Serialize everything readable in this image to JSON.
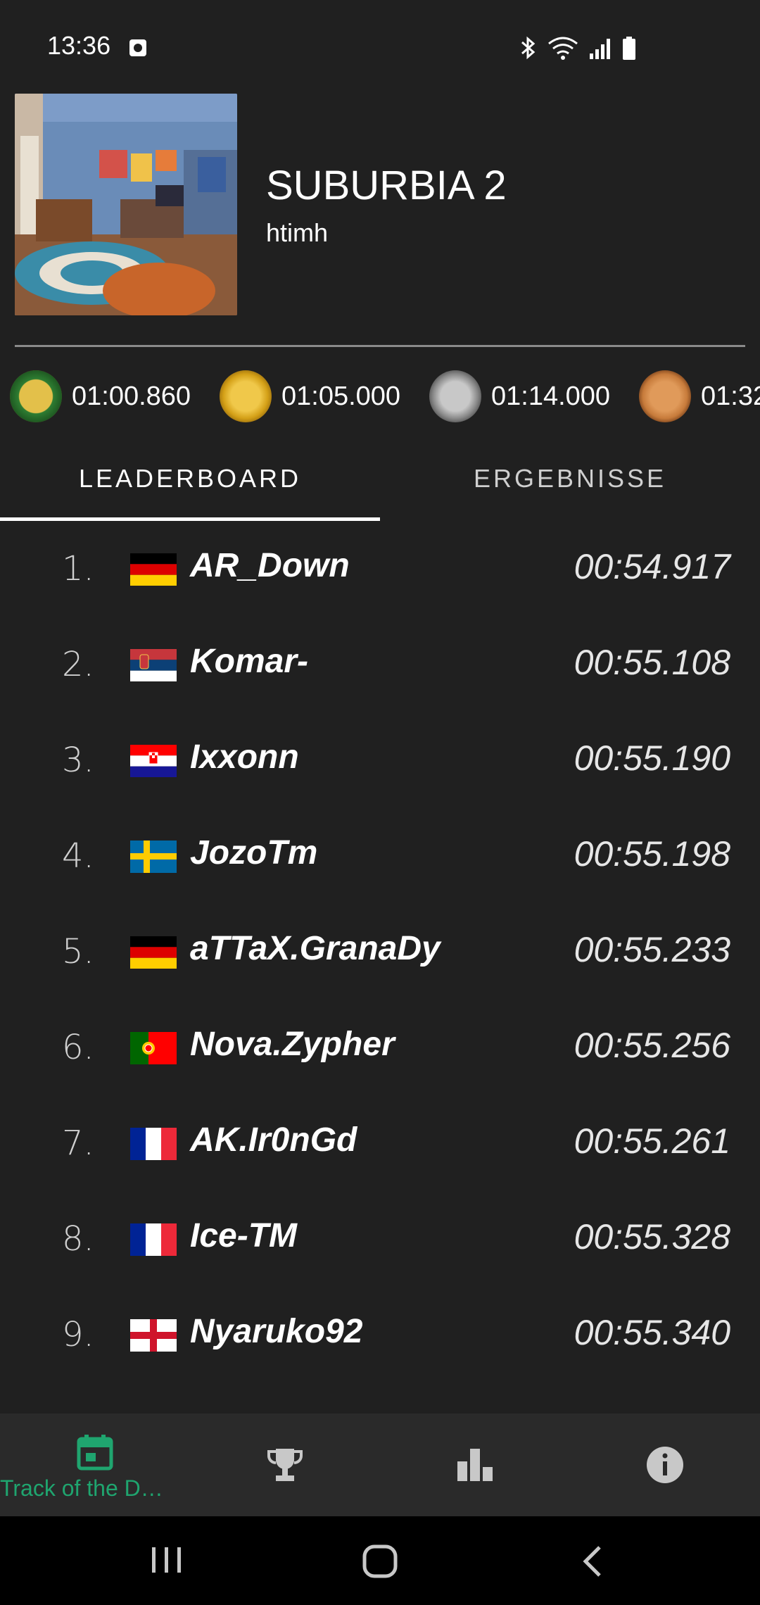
{
  "status_bar": {
    "time": "13:36"
  },
  "track": {
    "title": "SUBURBIA 2",
    "author": "htimh"
  },
  "medals": [
    {
      "name": "author-medal",
      "time": "01:00.860",
      "color": "#2e7d32"
    },
    {
      "name": "gold-medal",
      "time": "01:05.000",
      "color": "#d4a017"
    },
    {
      "name": "silver-medal",
      "time": "01:14.000",
      "color": "#9e9e9e"
    },
    {
      "name": "bronze-medal",
      "time": "01:32",
      "color": "#c77b3b"
    }
  ],
  "tabs": {
    "leaderboard": "LEADERBOARD",
    "results": "ERGEBNISSE"
  },
  "leaderboard": [
    {
      "rank": "1.",
      "country": "DE",
      "name": "AR_Down",
      "time": "00:54.917"
    },
    {
      "rank": "2.",
      "country": "RS",
      "name": "Komar-",
      "time": "00:55.108"
    },
    {
      "rank": "3.",
      "country": "HR",
      "name": "Ixxonn",
      "time": "00:55.190"
    },
    {
      "rank": "4.",
      "country": "SE",
      "name": "JozoTm",
      "time": "00:55.198"
    },
    {
      "rank": "5.",
      "country": "DE",
      "name": "aTTaX.GranaDy",
      "time": "00:55.233"
    },
    {
      "rank": "6.",
      "country": "PT",
      "name": "Nova.Zypher",
      "time": "00:55.256"
    },
    {
      "rank": "7.",
      "country": "FR",
      "name": "AK.Ir0nGd",
      "time": "00:55.261"
    },
    {
      "rank": "8.",
      "country": "FR",
      "name": "Ice-TM",
      "time": "00:55.328"
    },
    {
      "rank": "9.",
      "country": "EN",
      "name": "Nyaruko92",
      "time": "00:55.340"
    }
  ],
  "bottom_nav": {
    "track_of_day": "Track of the D…"
  },
  "colors": {
    "accent": "#1fa56f",
    "background": "#202020"
  }
}
